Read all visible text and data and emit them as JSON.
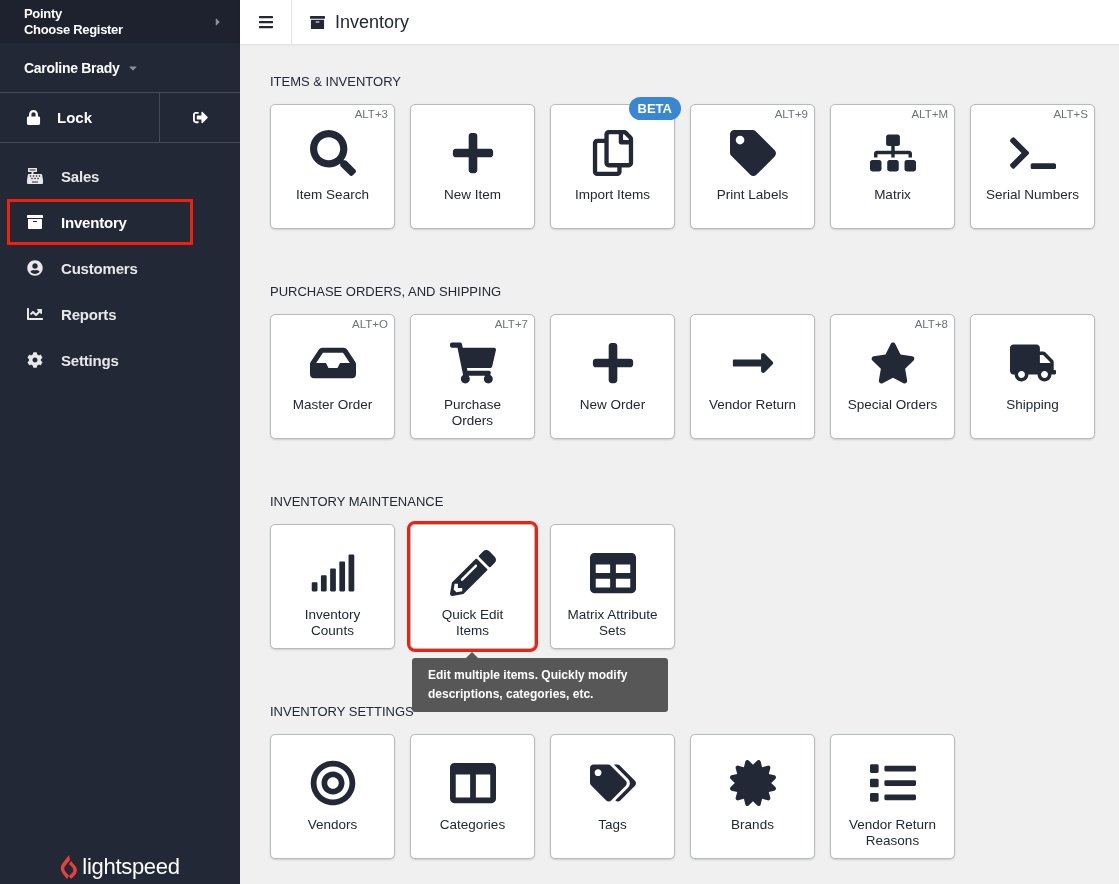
{
  "sidebar": {
    "shop": "Pointy",
    "register": "Choose Register",
    "user": "Caroline Brady",
    "lock": "Lock",
    "items": [
      {
        "label": "Sales",
        "selected": false,
        "highlighted": false
      },
      {
        "label": "Inventory",
        "selected": true,
        "highlighted": true
      },
      {
        "label": "Customers",
        "selected": false,
        "highlighted": false
      },
      {
        "label": "Reports",
        "selected": false,
        "highlighted": false
      },
      {
        "label": "Settings",
        "selected": false,
        "highlighted": false
      }
    ],
    "logo": "lightspeed"
  },
  "header": {
    "title": "Inventory"
  },
  "sections": [
    {
      "title": "ITEMS & INVENTORY",
      "tiles": [
        {
          "label": "Item Search",
          "shortcut": "ALT+3"
        },
        {
          "label": "New Item"
        },
        {
          "label": "Import Items",
          "badge": "BETA"
        },
        {
          "label": "Print Labels",
          "shortcut": "ALT+9"
        },
        {
          "label": "Matrix",
          "shortcut": "ALT+M"
        },
        {
          "label": "Serial Numbers",
          "shortcut": "ALT+S"
        }
      ]
    },
    {
      "title": "PURCHASE ORDERS, AND SHIPPING",
      "tiles": [
        {
          "label": "Master Order",
          "shortcut": "ALT+O"
        },
        {
          "label": "Purchase\nOrders",
          "shortcut": "ALT+7"
        },
        {
          "label": "New Order"
        },
        {
          "label": "Vendor Return"
        },
        {
          "label": "Special Orders",
          "shortcut": "ALT+8"
        },
        {
          "label": "Shipping"
        }
      ]
    },
    {
      "title": "INVENTORY MAINTENANCE",
      "tiles": [
        {
          "label": "Inventory\nCounts"
        },
        {
          "label": "Quick Edit\nItems",
          "highlighted": true,
          "tooltip": "Edit multiple items. Quickly modify descriptions, categories, etc."
        },
        {
          "label": "Matrix Attribute\nSets"
        }
      ]
    },
    {
      "title": "INVENTORY SETTINGS",
      "tiles": [
        {
          "label": "Vendors"
        },
        {
          "label": "Categories"
        },
        {
          "label": "Tags"
        },
        {
          "label": "Brands"
        },
        {
          "label": "Vendor Return\nReasons"
        }
      ]
    }
  ]
}
